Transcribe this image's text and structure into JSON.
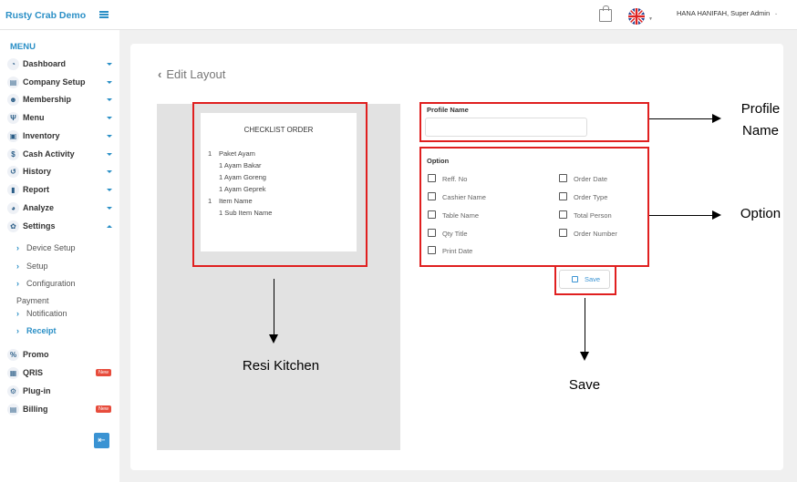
{
  "brand": {
    "name": "Rusty Crab Demo"
  },
  "sidebar": {
    "menu_title": "MENU",
    "items": [
      {
        "label": "Dashboard",
        "icon": "dashboard-icon",
        "glyph": "◔"
      },
      {
        "label": "Company Setup",
        "icon": "company-icon",
        "glyph": "▤"
      },
      {
        "label": "Membership",
        "icon": "users-icon",
        "glyph": "☻"
      },
      {
        "label": "Menu",
        "icon": "utensils-icon",
        "glyph": "Ψ"
      },
      {
        "label": "Inventory",
        "icon": "inventory-icon",
        "glyph": "▣"
      },
      {
        "label": "Cash Activity",
        "icon": "dollar-icon",
        "glyph": "$"
      },
      {
        "label": "History",
        "icon": "history-icon",
        "glyph": "↺"
      },
      {
        "label": "Report",
        "icon": "report-icon",
        "glyph": "▮"
      },
      {
        "label": "Analyze",
        "icon": "analyze-icon",
        "glyph": "◕"
      },
      {
        "label": "Settings",
        "icon": "gear-icon",
        "glyph": "✿"
      }
    ],
    "settings_sub": [
      "Device Setup",
      "Setup",
      "Configuration",
      "Payment",
      "Notification",
      "Receipt"
    ],
    "bottom_items": [
      {
        "label": "Promo",
        "icon": "percent-icon",
        "glyph": "%"
      },
      {
        "label": "QRIS",
        "icon": "qr-icon",
        "glyph": "▦",
        "badge": "New"
      },
      {
        "label": "Plug-in",
        "icon": "plugin-icon",
        "glyph": "⚙"
      },
      {
        "label": "Billing",
        "icon": "billing-icon",
        "glyph": "▤",
        "badge": "New"
      }
    ]
  },
  "topbar": {
    "user": "HANA HANIFAH, Super Admin"
  },
  "page": {
    "back_label": "Edit Layout"
  },
  "receipt": {
    "title": "CHECKLIST ORDER",
    "lines": [
      "1",
      "Paket Ayam",
      "1 Ayam Bakar",
      "1 Ayam Goreng",
      "1 Ayam Geprek",
      "1",
      "Item Name",
      "1 Sub Item Name"
    ]
  },
  "form": {
    "profile_name_label": "Profile Name",
    "profile_name_value": "",
    "option_label": "Option",
    "options_left": [
      "Reff. No",
      "Cashier Name",
      "Table Name",
      "Qty Title",
      "Print Date"
    ],
    "options_right": [
      "Order Date",
      "Order Type",
      "Total Person",
      "Order Number"
    ],
    "save_label": "Save"
  },
  "annotations": {
    "profile_name": "Profile\nName",
    "option": "Option",
    "resi_kitchen": "Resi Kitchen",
    "save": "Save",
    "box_color": "#e01f1f"
  }
}
